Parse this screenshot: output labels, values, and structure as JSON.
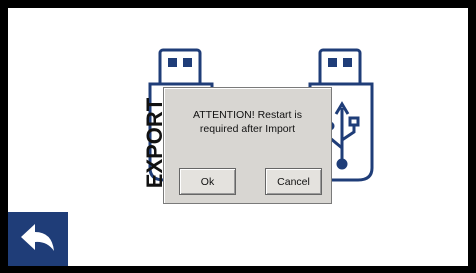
{
  "screen": {
    "export_label": "EXPORT",
    "export_icon": "usb-drive-icon",
    "import_icon": "usb-drive-icon"
  },
  "dialog": {
    "message": "ATTENTION! Restart is\nrequired after Import",
    "ok_label": "Ok",
    "cancel_label": "Cancel"
  },
  "nav": {
    "back_icon": "back-arrow-icon"
  },
  "colors": {
    "usb_blue": "#1f3d78",
    "background": "#ffffff",
    "dialog_bg": "#d8d6d2"
  }
}
